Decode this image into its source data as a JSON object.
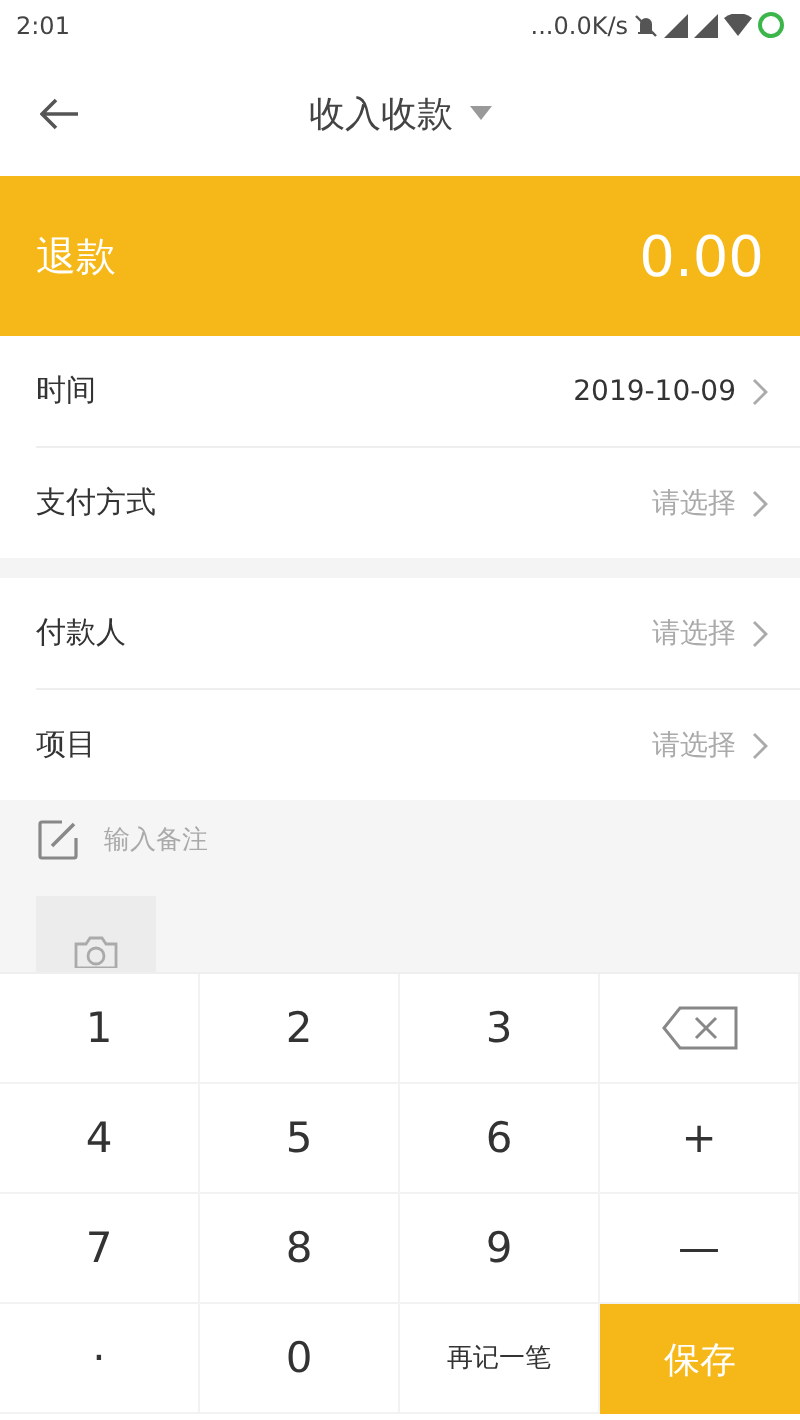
{
  "status_bar": {
    "time": "2:01",
    "speed": "...0.0K/s"
  },
  "header": {
    "title": "收入收款"
  },
  "amount_bar": {
    "label": "退款",
    "amount": "0.00"
  },
  "groups": [
    {
      "rows": [
        {
          "label": "时间",
          "value": "2019-10-09"
        },
        {
          "label": "支付方式",
          "placeholder": "请选择"
        }
      ]
    },
    {
      "rows": [
        {
          "label": "付款人",
          "placeholder": "请选择"
        },
        {
          "label": "项目",
          "placeholder": "请选择"
        }
      ]
    }
  ],
  "note": {
    "placeholder": "输入备注"
  },
  "keypad": [
    {
      "kind": "key",
      "label": "1"
    },
    {
      "kind": "key",
      "label": "2"
    },
    {
      "kind": "key",
      "label": "3"
    },
    {
      "kind": "backspace"
    },
    {
      "kind": "key",
      "label": "4"
    },
    {
      "kind": "key",
      "label": "5"
    },
    {
      "kind": "key",
      "label": "6"
    },
    {
      "kind": "key",
      "label": "+"
    },
    {
      "kind": "key",
      "label": "7"
    },
    {
      "kind": "key",
      "label": "8"
    },
    {
      "kind": "key",
      "label": "9"
    },
    {
      "kind": "key",
      "label": "—"
    },
    {
      "kind": "key",
      "label": "·"
    },
    {
      "kind": "key",
      "label": "0"
    },
    {
      "kind": "small",
      "label": "再记一笔"
    },
    {
      "kind": "save",
      "label": "保存"
    }
  ]
}
